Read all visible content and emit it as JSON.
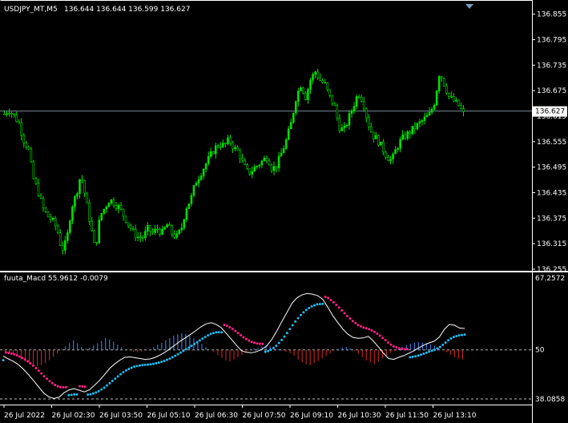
{
  "price_panel": {
    "symbol": "USDJPY_MT,M5",
    "ohlc": "136.644 136.644 136.599 136.627",
    "current_price": "136.627",
    "current_price_value": 136.627
  },
  "indicator_panel": {
    "title": "fuuta_Macd 55.9612  -0.0079",
    "axis_labels": [
      "67.2572",
      "50",
      "38.0858"
    ]
  },
  "colors": {
    "background": "#000000",
    "bull_candle": "#00e000",
    "bear_candle": "#000000",
    "hist_pos": "#3a78d8",
    "hist_neg": "#c02020",
    "dots_blue": "#22bbee",
    "dots_pink": "#ff2288",
    "main_line": "#ffffff",
    "price_line": "#7a8a99"
  },
  "chart_data": [
    {
      "type": "candlestick",
      "title": "USDJPY_MT,M5",
      "y_ticks": [
        "136.855",
        "136.795",
        "136.735",
        "136.675",
        "136.615",
        "136.555",
        "136.495",
        "136.435",
        "136.375",
        "136.315",
        "136.255"
      ],
      "ylim": [
        136.255,
        136.86
      ],
      "x_ticks": [
        "26 Jul 2022",
        "26 Jul 02:30",
        "26 Jul 03:50",
        "26 Jul 05:10",
        "26 Jul 06:30",
        "26 Jul 07:50",
        "26 Jul 09:10",
        "26 Jul 10:30",
        "26 Jul 11:50",
        "26 Jul 13:10"
      ],
      "close_series": [
        136.62,
        136.63,
        136.615,
        136.6,
        136.56,
        136.54,
        136.47,
        136.44,
        136.4,
        136.38,
        136.37,
        136.35,
        136.3,
        136.32,
        136.4,
        136.43,
        136.48,
        136.42,
        136.36,
        136.3,
        136.38,
        136.4,
        136.42,
        136.41,
        136.4,
        136.38,
        136.36,
        136.34,
        136.33,
        136.33,
        136.35,
        136.34,
        136.35,
        136.34,
        136.36,
        136.34,
        136.33,
        136.35,
        136.4,
        136.42,
        136.46,
        136.48,
        136.5,
        136.52,
        136.54,
        136.55,
        136.545,
        136.56,
        136.54,
        136.53,
        136.5,
        136.48,
        136.49,
        136.5,
        136.51,
        136.52,
        136.49,
        136.5,
        136.53,
        136.56,
        136.6,
        136.66,
        136.69,
        136.66,
        136.7,
        136.72,
        136.7,
        136.69,
        136.66,
        136.64,
        136.59,
        136.58,
        136.61,
        136.64,
        136.67,
        136.65,
        136.6,
        136.57,
        136.56,
        136.54,
        136.52,
        136.51,
        136.54,
        136.56,
        136.57,
        136.58,
        136.59,
        136.6,
        136.61,
        136.62,
        136.65,
        136.72,
        136.69,
        136.66,
        136.65,
        136.64,
        136.62
      ]
    },
    {
      "type": "bar",
      "title": "fuuta_Macd 55.9612  -0.0079",
      "ylim": [
        38.0858,
        67.2572
      ],
      "baseline": 50,
      "histogram": [
        -0.4,
        -0.8,
        -1.2,
        -1.8,
        -2.6,
        -3.2,
        -3.8,
        -4.2,
        -4.4,
        -4.1,
        -3.6,
        -2.8,
        -1.9,
        -0.9,
        0.2,
        0.9,
        1.8,
        2.6,
        1.8,
        0.8,
        0.3,
        0.6,
        1.2,
        1.8,
        2.4,
        3.2,
        2.8,
        2.2,
        1.4,
        0.7,
        0.2,
        -0.2,
        -0.5,
        -0.6,
        -0.4,
        -0.2,
        0.2,
        0.8,
        1.4,
        1.9,
        2.6,
        3.2,
        3.8,
        4.2,
        4.5,
        4.3,
        3.8,
        3.1,
        2.4,
        1.6,
        0.8,
        0.1,
        -0.6,
        -1.4,
        -2.2,
        -2.8,
        -3.1,
        -2.6,
        -2.0,
        -1.3,
        -0.6,
        0.1,
        0.4,
        0.6,
        0.9,
        1.3,
        1.0,
        0.6,
        0.2,
        -0.2,
        -0.5,
        -0.9,
        -1.6,
        -2.6,
        -3.4,
        -3.9,
        -4.1,
        -3.6,
        -3.0,
        -2.3,
        -1.6,
        -0.9,
        -0.2,
        0.3,
        0.6,
        0.8,
        0.4,
        -0.3,
        -1.1,
        -2.0,
        -2.9,
        -3.4,
        -3.8,
        -3.1,
        -2.3,
        -1.5,
        -0.8,
        -0.3,
        0.2,
        0.8,
        1.3,
        1.7,
        1.9,
        2.1,
        2.0,
        1.8,
        1.5,
        1.1,
        0.5,
        0.0,
        -0.6,
        -1.3,
        -1.9,
        -2.3,
        -2.6
      ],
      "main_line": [
        48.5,
        47.8,
        47.2,
        46.4,
        45.3,
        44.0,
        42.5,
        41.0,
        39.5,
        38.6,
        38.2,
        38.5,
        39.6,
        40.3,
        40.6,
        40.2,
        39.8,
        40.3,
        41.4,
        42.6,
        44.0,
        45.5,
        46.6,
        47.5,
        48.2,
        48.3,
        48.1,
        47.9,
        47.7,
        47.8,
        48.2,
        48.8,
        49.5,
        50.4,
        51.3,
        52.2,
        53.0,
        53.8,
        54.7,
        55.6,
        56.3,
        56.6,
        56.2,
        55.4,
        54.0,
        52.6,
        51.1,
        49.8,
        49.4,
        49.3,
        49.6,
        50.1,
        51.0,
        52.6,
        54.7,
        57.0,
        59.2,
        61.4,
        62.7,
        63.4,
        63.7,
        63.5,
        63.2,
        62.3,
        60.4,
        58.3,
        56.6,
        55.0,
        53.8,
        53.0,
        52.8,
        52.9,
        53.3,
        52.1,
        50.7,
        49.2,
        47.9,
        47.7,
        48.2,
        48.6,
        49.2,
        49.8,
        50.5,
        51.2,
        51.7,
        52.1,
        53.1,
        55.0,
        56.2,
        56.0,
        55.3,
        55.2
      ]
    }
  ]
}
